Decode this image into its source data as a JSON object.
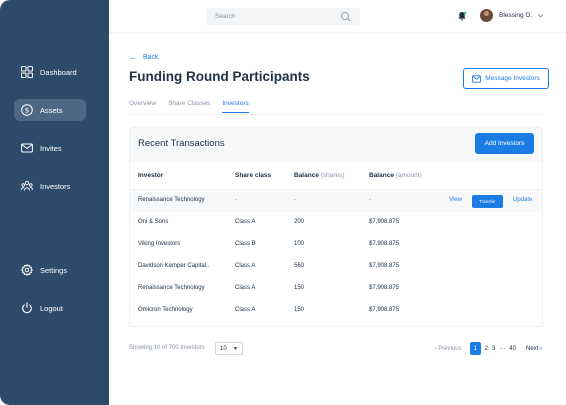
{
  "sidebar": {
    "items": [
      {
        "label": "Dashboard",
        "icon": "dashboard-grid-icon",
        "active": false
      },
      {
        "label": "Assets",
        "icon": "dollar-circle-icon",
        "active": true
      },
      {
        "label": "Invites",
        "icon": "mail-icon",
        "active": false
      },
      {
        "label": "Investors",
        "icon": "people-icon",
        "active": false
      },
      {
        "label": "Settings",
        "icon": "gear-icon",
        "active": false
      },
      {
        "label": "Logout",
        "icon": "power-icon",
        "active": false
      }
    ]
  },
  "header": {
    "search_placeholder": "Search",
    "user_name": "Blessing O."
  },
  "page": {
    "back_label": "Back",
    "title": "Funding Round Participants",
    "message_button": "Message Investors",
    "tabs": [
      {
        "label": "Overview",
        "active": false
      },
      {
        "label": "Share Classes",
        "active": false
      },
      {
        "label": "Investors",
        "active": true
      }
    ]
  },
  "card": {
    "title": "Recent Transactions",
    "add_button": "Add Investors",
    "columns": {
      "investor": "Investor",
      "share_class": "Share class",
      "balance_shares": "Balance",
      "balance_shares_unit": "(shares)",
      "balance_amount": "Balance",
      "balance_amount_unit": "(amount)"
    },
    "rows": [
      {
        "investor": "Renaissance Technology",
        "share_class": "-",
        "shares": "-",
        "amount": "-"
      },
      {
        "investor": "Oni & Sons",
        "share_class": "Class A",
        "shares": "200",
        "amount": "$7,908.875"
      },
      {
        "investor": "Viking Investors",
        "share_class": "Class B",
        "shares": "100",
        "amount": "$7,908.875"
      },
      {
        "investor": "Davidson Kemper Capital..",
        "share_class": "Class A",
        "shares": "560",
        "amount": "$7,908.875"
      },
      {
        "investor": "Renaissance Technology",
        "share_class": "Class A",
        "shares": "150",
        "amount": "$7,908.875"
      },
      {
        "investor": "Omicron Technology",
        "share_class": "Class A",
        "shares": "150",
        "amount": "$7,908.875"
      }
    ],
    "row_actions": {
      "view": "View",
      "transfer": "Transfer",
      "update": "Update"
    }
  },
  "pagination": {
    "showing": "Showing 10 of 700 Investors",
    "per_page": "10",
    "previous": "Previous",
    "pages": [
      "1",
      "2",
      "3",
      "···",
      "40"
    ],
    "next": "Next"
  },
  "colors": {
    "sidebar": "#2e4a6b",
    "accent": "#1c7ce6"
  }
}
